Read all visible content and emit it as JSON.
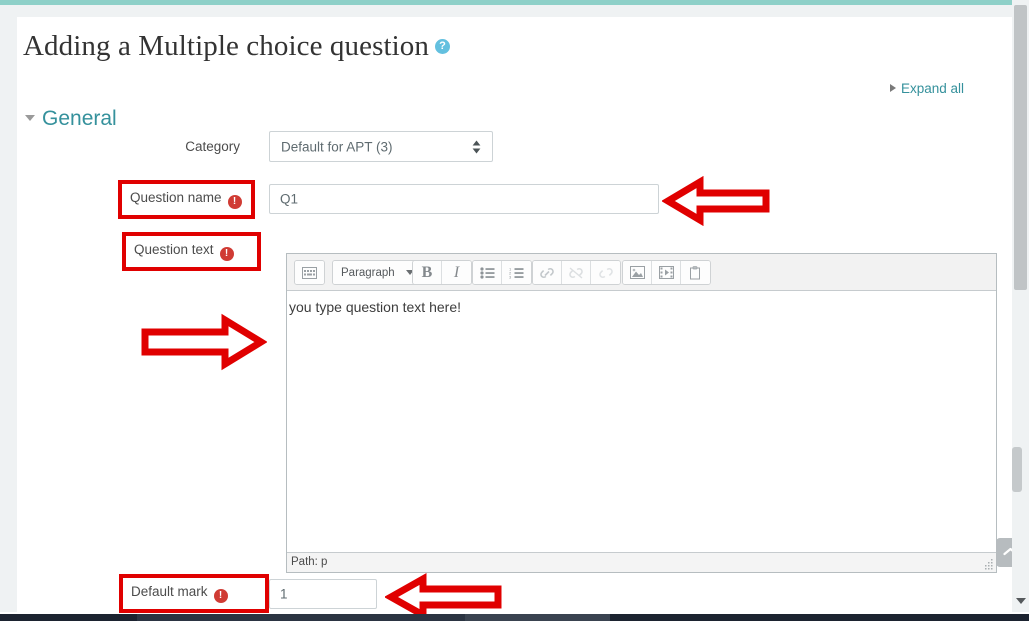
{
  "page": {
    "title": "Adding a Multiple choice question",
    "help_icon": "help-circle-icon",
    "expand_all": "Expand all",
    "section_general": "General"
  },
  "form": {
    "category": {
      "label": "Category",
      "value": "Default for APT (3)"
    },
    "question_name": {
      "label": "Question name",
      "required_icon": "required-exclamation-icon",
      "value": "Q1",
      "placeholder": ""
    },
    "question_text": {
      "label": "Question text",
      "required_icon": "required-exclamation-icon",
      "content": "you type question text here!"
    },
    "default_mark": {
      "label": "Default mark",
      "required_icon": "required-exclamation-icon",
      "value": "1",
      "placeholder": ""
    }
  },
  "editor": {
    "format_select": "Paragraph",
    "status_path": "Path: p",
    "buttons": [
      {
        "name": "expand-toolbar-icon",
        "glyph": "⌸",
        "disabled": false
      },
      {
        "name": "bold-icon",
        "glyph": "B",
        "disabled": false
      },
      {
        "name": "italic-icon",
        "glyph": "I",
        "disabled": false
      },
      {
        "name": "bullet-list-icon",
        "glyph": "☰",
        "disabled": false
      },
      {
        "name": "numbered-list-icon",
        "glyph": "☰",
        "disabled": false
      },
      {
        "name": "link-icon",
        "glyph": "🔗",
        "disabled": false
      },
      {
        "name": "unlink-icon",
        "glyph": "✂",
        "disabled": true
      },
      {
        "name": "auto-link-icon",
        "glyph": "🔗",
        "disabled": true
      },
      {
        "name": "image-icon",
        "glyph": "⛰",
        "disabled": false
      },
      {
        "name": "media-icon",
        "glyph": "🎞",
        "disabled": false
      },
      {
        "name": "paste-icon",
        "glyph": "📋",
        "disabled": false
      }
    ]
  },
  "annotations": {
    "highlight_question_name": "red-highlight-box",
    "highlight_question_text": "red-highlight-box",
    "highlight_default_mark": "red-highlight-box",
    "arrow_question_name": "red-arrow-left",
    "arrow_question_text": "red-arrow-right",
    "arrow_default_mark": "red-arrow-left"
  },
  "controls": {
    "scroll_top": "scroll-to-top-button",
    "scrollbar": "vertical-scrollbar"
  },
  "colors": {
    "accent_teal": "#35919c",
    "top_bar": "#8ed0c8",
    "annotation_red": "#e00000",
    "required_red": "#d03b34",
    "help_blue": "#63c0df"
  }
}
